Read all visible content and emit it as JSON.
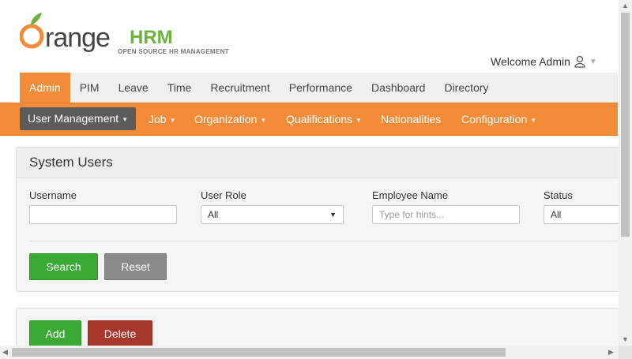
{
  "logo": {
    "brand_main": "range",
    "brand_hrm": "HRM",
    "tagline": "OPEN SOURCE HR MANAGEMENT"
  },
  "header": {
    "welcome": "Welcome Admin"
  },
  "main_nav": [
    "Admin",
    "PIM",
    "Leave",
    "Time",
    "Recruitment",
    "Performance",
    "Dashboard",
    "Directory"
  ],
  "sub_nav": [
    "User Management",
    "Job",
    "Organization",
    "Qualifications",
    "Nationalities",
    "Configuration"
  ],
  "search_panel": {
    "title": "System Users",
    "username_label": "Username",
    "username_value": "",
    "user_role_label": "User Role",
    "user_role_value": "All",
    "employee_name_label": "Employee Name",
    "employee_name_placeholder": "Type for hints...",
    "status_label": "Status",
    "status_value": "All",
    "search_button": "Search",
    "reset_button": "Reset"
  },
  "list_panel": {
    "add_button": "Add",
    "delete_button": "Delete"
  },
  "colors": {
    "accent": "#f28c38",
    "green": "#3aaa35",
    "red": "#a8372b",
    "dark_gray": "#5b5b5b"
  }
}
